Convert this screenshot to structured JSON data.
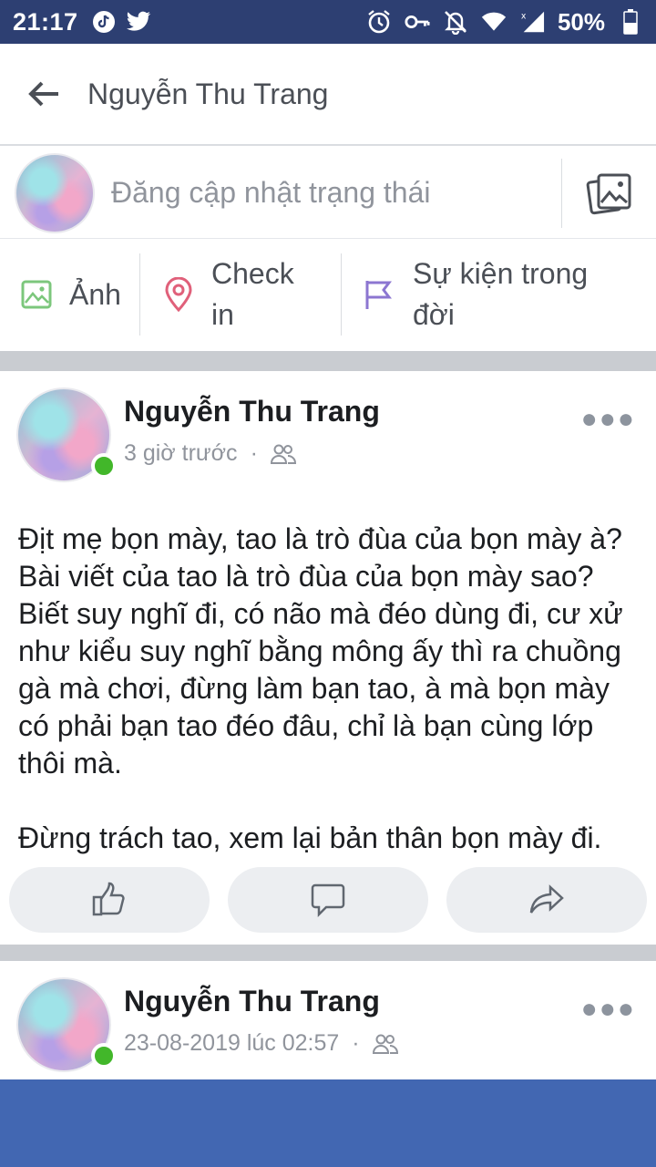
{
  "status_bar": {
    "time": "21:17",
    "battery": "50%",
    "icons": [
      "tiktok-icon",
      "twitter-icon",
      "alarm-icon",
      "key-icon",
      "bell-off-icon",
      "wifi-icon",
      "signal-icon",
      "battery-icon"
    ]
  },
  "header": {
    "title": "Nguyễn Thu Trang"
  },
  "composer": {
    "placeholder": "Đăng cập nhật trạng thái"
  },
  "actions": {
    "photo": "Ảnh",
    "checkin": "Check in",
    "life_event": "Sự kiện trong đời"
  },
  "posts": [
    {
      "author": "Nguyễn Thu Trang",
      "time": "3 giờ trước",
      "audience_icon": "friends-icon",
      "paragraphs": [
        "Địt mẹ bọn mày, tao là trò đùa của bọn mày à? Bài viết của tao là trò đùa của bọn mày sao? Biết suy nghĩ đi, có não mà đéo dùng đi, cư xử như kiểu suy nghĩ bằng mông ấy thì ra chuồng gà mà chơi, đừng làm bạn tao, à mà bọn mày có phải bạn tao đéo đâu, chỉ là bạn cùng lớp thôi mà.",
        "Đừng trách tao, xem lại bản thân bọn mày đi."
      ]
    },
    {
      "author": "Nguyễn Thu Trang",
      "time": "23-08-2019 lúc 02:57",
      "audience_icon": "friends-icon"
    }
  ],
  "colors": {
    "status_bar": "#2d3f72",
    "facebook_blue": "#4267b2",
    "online_green": "#42b72a",
    "photo_green": "#7cc77c",
    "checkin_red": "#e0607a",
    "life_purple": "#8c76d1"
  }
}
